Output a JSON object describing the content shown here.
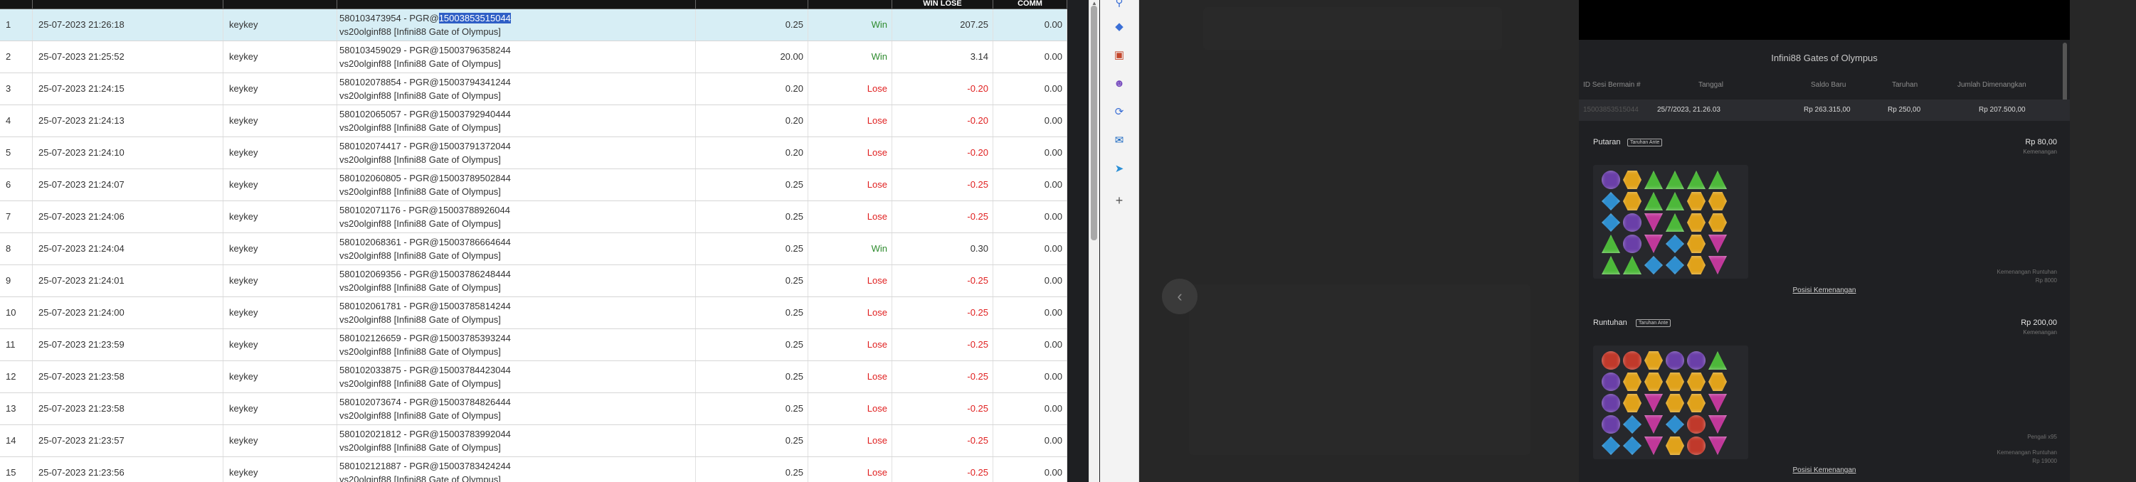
{
  "table": {
    "headers": [
      "",
      "",
      "",
      "",
      "",
      "",
      "WIN LOSE",
      "COMM"
    ],
    "rows": [
      {
        "no": "1",
        "date": "25-07-2023 21:26:18",
        "user": "keykey",
        "ref_prefix": "580103473954 - PGR@",
        "ref_id": "15003853515044",
        "game": "vs20olginf88 [Infini88 Gate of Olympus]",
        "bet": "0.25",
        "result": "Win",
        "winlose": "207.25",
        "comm": "0.00",
        "selected": true
      },
      {
        "no": "2",
        "date": "25-07-2023 21:25:52",
        "user": "keykey",
        "ref_prefix": "580103459029 - PGR@",
        "ref_id": "15003796358244",
        "game": "vs20olginf88 [Infini88 Gate of Olympus]",
        "bet": "20.00",
        "result": "Win",
        "winlose": "3.14",
        "comm": "0.00"
      },
      {
        "no": "3",
        "date": "25-07-2023 21:24:15",
        "user": "keykey",
        "ref_prefix": "580102078854 - PGR@",
        "ref_id": "15003794341244",
        "game": "vs20olginf88 [Infini88 Gate of Olympus]",
        "bet": "0.20",
        "result": "Lose",
        "winlose": "-0.20",
        "comm": "0.00"
      },
      {
        "no": "4",
        "date": "25-07-2023 21:24:13",
        "user": "keykey",
        "ref_prefix": "580102065057 - PGR@",
        "ref_id": "15003792940444",
        "game": "vs20olginf88 [Infini88 Gate of Olympus]",
        "bet": "0.20",
        "result": "Lose",
        "winlose": "-0.20",
        "comm": "0.00"
      },
      {
        "no": "5",
        "date": "25-07-2023 21:24:10",
        "user": "keykey",
        "ref_prefix": "580102074417 - PGR@",
        "ref_id": "15003791372044",
        "game": "vs20olginf88 [Infini88 Gate of Olympus]",
        "bet": "0.20",
        "result": "Lose",
        "winlose": "-0.20",
        "comm": "0.00"
      },
      {
        "no": "6",
        "date": "25-07-2023 21:24:07",
        "user": "keykey",
        "ref_prefix": "580102060805 - PGR@",
        "ref_id": "15003789502844",
        "game": "vs20olginf88 [Infini88 Gate of Olympus]",
        "bet": "0.25",
        "result": "Lose",
        "winlose": "-0.25",
        "comm": "0.00"
      },
      {
        "no": "7",
        "date": "25-07-2023 21:24:06",
        "user": "keykey",
        "ref_prefix": "580102071176 - PGR@",
        "ref_id": "15003788926044",
        "game": "vs20olginf88 [Infini88 Gate of Olympus]",
        "bet": "0.25",
        "result": "Lose",
        "winlose": "-0.25",
        "comm": "0.00"
      },
      {
        "no": "8",
        "date": "25-07-2023 21:24:04",
        "user": "keykey",
        "ref_prefix": "580102068361 - PGR@",
        "ref_id": "15003786664644",
        "game": "vs20olginf88 [Infini88 Gate of Olympus]",
        "bet": "0.25",
        "result": "Win",
        "winlose": "0.30",
        "comm": "0.00"
      },
      {
        "no": "9",
        "date": "25-07-2023 21:24:01",
        "user": "keykey",
        "ref_prefix": "580102069356 - PGR@",
        "ref_id": "15003786248444",
        "game": "vs20olginf88 [Infini88 Gate of Olympus]",
        "bet": "0.25",
        "result": "Lose",
        "winlose": "-0.25",
        "comm": "0.00"
      },
      {
        "no": "10",
        "date": "25-07-2023 21:24:00",
        "user": "keykey",
        "ref_prefix": "580102061781 - PGR@",
        "ref_id": "15003785814244",
        "game": "vs20olginf88 [Infini88 Gate of Olympus]",
        "bet": "0.25",
        "result": "Lose",
        "winlose": "-0.25",
        "comm": "0.00"
      },
      {
        "no": "11",
        "date": "25-07-2023 21:23:59",
        "user": "keykey",
        "ref_prefix": "580102126659 - PGR@",
        "ref_id": "15003785393244",
        "game": "vs20olginf88 [Infini88 Gate of Olympus]",
        "bet": "0.25",
        "result": "Lose",
        "winlose": "-0.25",
        "comm": "0.00"
      },
      {
        "no": "12",
        "date": "25-07-2023 21:23:58",
        "user": "keykey",
        "ref_prefix": "580102033875 - PGR@",
        "ref_id": "15003784423044",
        "game": "vs20olginf88 [Infini88 Gate of Olympus]",
        "bet": "0.25",
        "result": "Lose",
        "winlose": "-0.25",
        "comm": "0.00"
      },
      {
        "no": "13",
        "date": "25-07-2023 21:23:58",
        "user": "keykey",
        "ref_prefix": "580102073674 - PGR@",
        "ref_id": "15003784826444",
        "game": "vs20olginf88 [Infini88 Gate of Olympus]",
        "bet": "0.25",
        "result": "Lose",
        "winlose": "-0.25",
        "comm": "0.00"
      },
      {
        "no": "14",
        "date": "25-07-2023 21:23:57",
        "user": "keykey",
        "ref_prefix": "580102021812 - PGR@",
        "ref_id": "15003783992044",
        "game": "vs20olginf88 [Infini88 Gate of Olympus]",
        "bet": "0.25",
        "result": "Lose",
        "winlose": "-0.25",
        "comm": "0.00"
      },
      {
        "no": "15",
        "date": "25-07-2023 21:23:56",
        "user": "keykey",
        "ref_prefix": "580102121887 - PGR@",
        "ref_id": "15003783424244",
        "game": "vs20olginf88 [Infini88 Gate of Olympus]",
        "bet": "0.25",
        "result": "Lose",
        "winlose": "-0.25",
        "comm": "0.00"
      }
    ]
  },
  "sidebar": {
    "icons": [
      "search-icon",
      "tag-icon",
      "toolbox-icon",
      "people-icon",
      "sync-icon",
      "outlook-icon",
      "cart-icon",
      "add-icon"
    ]
  },
  "receipt": {
    "title": "Infini88 Gates of Olympus",
    "headers": {
      "id": "ID Sesi Bermain #",
      "date": "Tanggal",
      "balance": "Saldo Baru",
      "bet": "Taruhan",
      "won": "Jumlah Dimenangkan"
    },
    "values": {
      "id": "15003853515044",
      "date": "25/7/2023, 21.26.03",
      "balance": "Rp 263.315,00",
      "bet": "Rp 250,00",
      "won": "Rp 207.500,00"
    },
    "spin": {
      "title": "Putaran",
      "badge": "Taruhan Ante",
      "amount": "Rp 80,00",
      "amount_sub": "Kemenangan",
      "note_label": "Kemenangan Runtuhan",
      "note_value": "Rp 8000",
      "link": "Posisi Kemenangan"
    },
    "tumble": {
      "title": "Runtuhan",
      "badge": "Taruhan Ante",
      "amount": "Rp 200,00",
      "amount_sub": "Kemenangan",
      "note_top": "Pengali x95",
      "note_label": "Kemenangan Runtuhan",
      "note_value": "Rp 19000",
      "link": "Posisi Kemenangan"
    }
  },
  "colors": {
    "win": "#2e8b2e",
    "lose": "#e02020",
    "selected_row": "#d7eef5",
    "highlight": "#2f5fc6"
  }
}
